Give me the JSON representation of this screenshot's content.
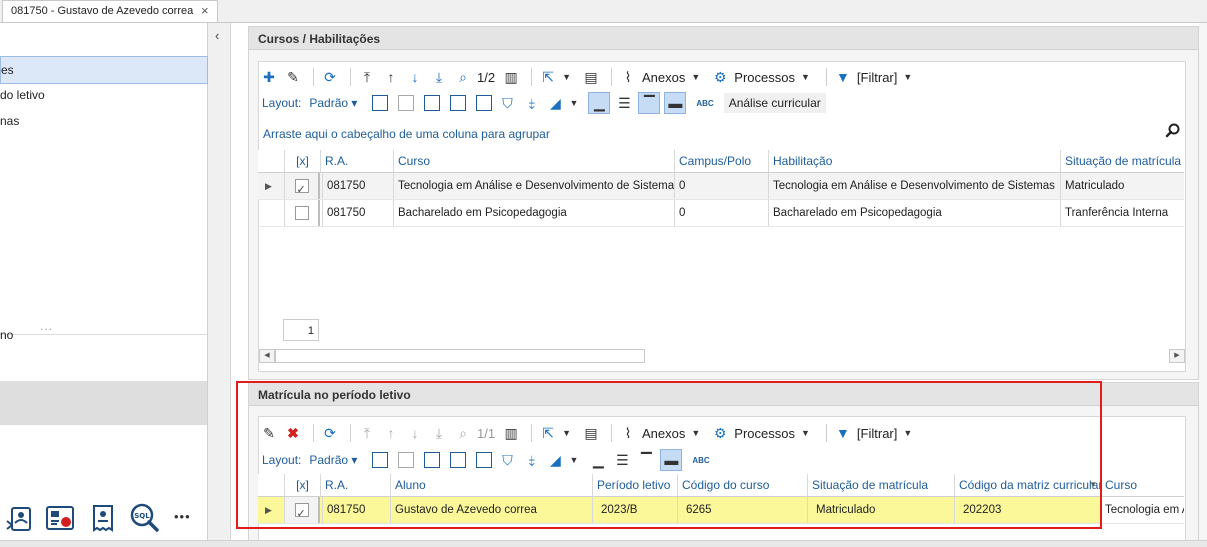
{
  "window": {
    "tab_title": "081750 - Gustavo de Azevedo correa",
    "close_glyph": "×"
  },
  "sidebar": {
    "items": [
      {
        "label": "es"
      },
      {
        "label": "do letivo"
      },
      {
        "label": "nas"
      },
      {
        "label": "no"
      }
    ],
    "more_dots": "...",
    "bottom_more": "•••",
    "bottom_icons": [
      "student-card-icon",
      "report-chart-icon",
      "receipt-icon",
      "sql-search-icon"
    ],
    "sql_label": "SQL"
  },
  "panel_cursos": {
    "title": "Cursos / Habilitações",
    "record_counter": "1/2",
    "anexos": "Anexos",
    "processos": "Processos",
    "filtrar": "[Filtrar]",
    "layout_label": "Layout:",
    "padrao": "Padrão",
    "analise": "Análise curricular",
    "group_hint": "Arraste aqui o cabeçalho de uma coluna para agrupar",
    "columns": [
      "[x]",
      "R.A.",
      "Curso",
      "Campus/Polo",
      "Habilitação",
      "Situação de matrícula"
    ],
    "rows": [
      {
        "checked": true,
        "ra": "081750",
        "curso": "Tecnologia em Análise e Desenvolvimento de Sistemas",
        "campus": "0",
        "habilitacao": "Tecnologia em Análise e Desenvolvimento de Sistemas",
        "situacao": "Matriculado"
      },
      {
        "checked": false,
        "ra": "081750",
        "curso": "Bacharelado em Psicopedagogia",
        "campus": "0",
        "habilitacao": "Bacharelado em Psicopedagogia",
        "situacao": "Tranferência Interna"
      }
    ],
    "page_number": "1"
  },
  "panel_matricula": {
    "title": "Matrícula no período letivo",
    "record_counter": "1/1",
    "anexos": "Anexos",
    "processos": "Processos",
    "filtrar": "[Filtrar]",
    "layout_label": "Layout:",
    "padrao": "Padrão",
    "columns": [
      "[x]",
      "R.A.",
      "Aluno",
      "Período letivo",
      "Código do curso",
      "Situação de matrícula",
      "Código da matriz curricular",
      "Curso"
    ],
    "rows": [
      {
        "checked": true,
        "ra": "081750",
        "aluno": "Gustavo de Azevedo correa",
        "periodo": "2023/B",
        "codigo_curso": "6265",
        "situacao": "Matriculado",
        "matriz": "202203",
        "curso": "Tecnologia em A"
      }
    ]
  },
  "colors": {
    "accent_blue": "#1e5d9a",
    "highlight_yellow": "#fbf89a",
    "annotation_red": "#e21b1b"
  }
}
